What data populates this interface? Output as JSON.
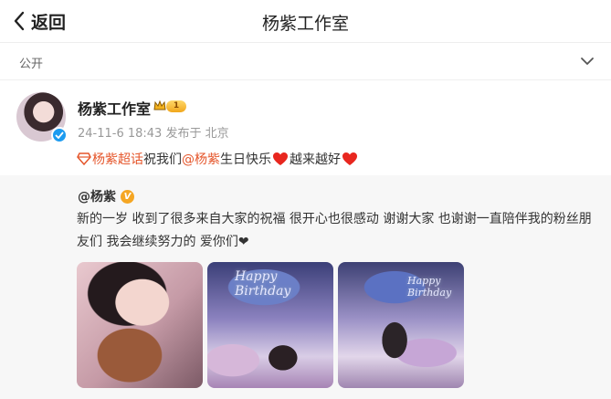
{
  "topbar": {
    "back_label": "返回",
    "title": "杨紫工作室"
  },
  "visibility": {
    "label": "公开"
  },
  "post": {
    "author": "杨紫工作室",
    "level_badge": "1",
    "meta": "24-11-6 18:43 发布于 北京",
    "content": {
      "topic_link": "杨紫超话",
      "text1": "祝我们",
      "mention": "@杨紫",
      "text2": " 生日快乐",
      "text3": "越来越好"
    }
  },
  "repost": {
    "author": "@杨紫",
    "badge": "V",
    "text": "新的一岁 收到了很多来自大家的祝福 很开心也很感动 谢谢大家 也谢谢一直陪伴我的粉丝朋友们 我会继续努力的 爱你们❤",
    "images": [
      {
        "overlay": ""
      },
      {
        "overlay": "Happy Birthday"
      },
      {
        "overlay": "Happy Birthday"
      }
    ]
  },
  "colors": {
    "link": "#e5562b",
    "verified": "#1d9bf0",
    "repost_bg": "#f7f7f7"
  }
}
